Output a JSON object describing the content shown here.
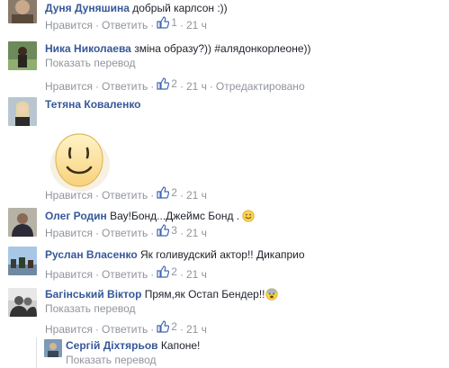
{
  "actions": {
    "like": "Нравится",
    "reply": "Ответить",
    "sep": "·"
  },
  "comments": [
    {
      "author": "Дуня Дуняшина",
      "text": "добрый карлсон :))",
      "likes": "1",
      "time": "21 ч"
    },
    {
      "author": "Ника Николаева",
      "text": "зміна образу?)) #алядонкорлеоне))",
      "translate": "Показать перевод",
      "likes": "2",
      "time": "21 ч",
      "edited": "Отредактировано"
    },
    {
      "author": "Тетяна Коваленко",
      "text": "",
      "sticker": "smiley-sticker",
      "likes": "2",
      "time": "21 ч"
    },
    {
      "author": "Олег Родин",
      "text": "Вау!Бонд...Джеймс Бонд .",
      "emoji": "smile-emoji-icon",
      "likes": "3",
      "time": "21 ч"
    },
    {
      "author": "Руслан Власенко",
      "text": "Як голивудский актор!! Дикаприо",
      "likes": "2",
      "time": "21 ч"
    },
    {
      "author": "Багінський Віктор",
      "text": "Прям,як Остап Бендер!!",
      "emoji": "fearful-emoji-icon",
      "translate": "Показать перевод",
      "likes": "2",
      "time": "21 ч"
    },
    {
      "author": "Сергій Діхтярьов",
      "text": "Капоне!",
      "translate": "Показать перевод"
    }
  ],
  "colors": {
    "author": "#365899",
    "meta": "#90949c",
    "like_blue": "#4267b2",
    "text": "#1d2129"
  }
}
